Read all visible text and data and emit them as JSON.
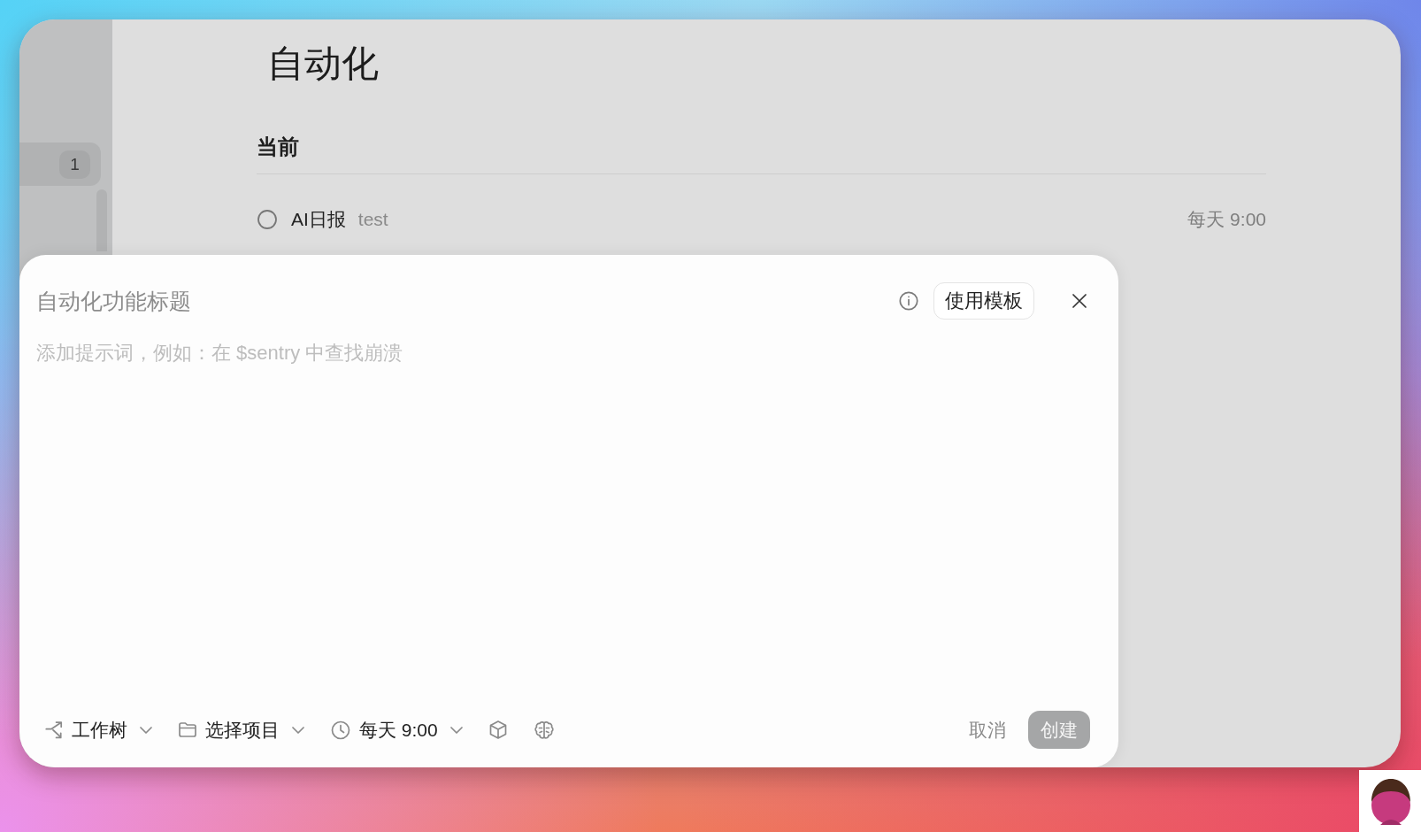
{
  "window": {
    "title": "自动化"
  },
  "sidebar": {
    "items": [
      {
        "badge": "1",
        "selected": true
      }
    ]
  },
  "current": {
    "heading": "当前",
    "items": [
      {
        "name": "AI日报",
        "description": "test",
        "schedule": "每天 9:00",
        "checked": false
      }
    ]
  },
  "dialog": {
    "title_field": {
      "placeholder": "自动化功能标题"
    },
    "template_button": "使用模板",
    "prompt_field": {
      "placeholder": "添加提示词，例如：在 $sentry 中查找崩溃"
    },
    "options": [
      {
        "label": "工作树"
      },
      {
        "label": "选择项目"
      },
      {
        "label": "每天 9:00"
      }
    ],
    "cancel_button": "取消",
    "create_button": {
      "label": "创建",
      "disabled": true
    }
  }
}
